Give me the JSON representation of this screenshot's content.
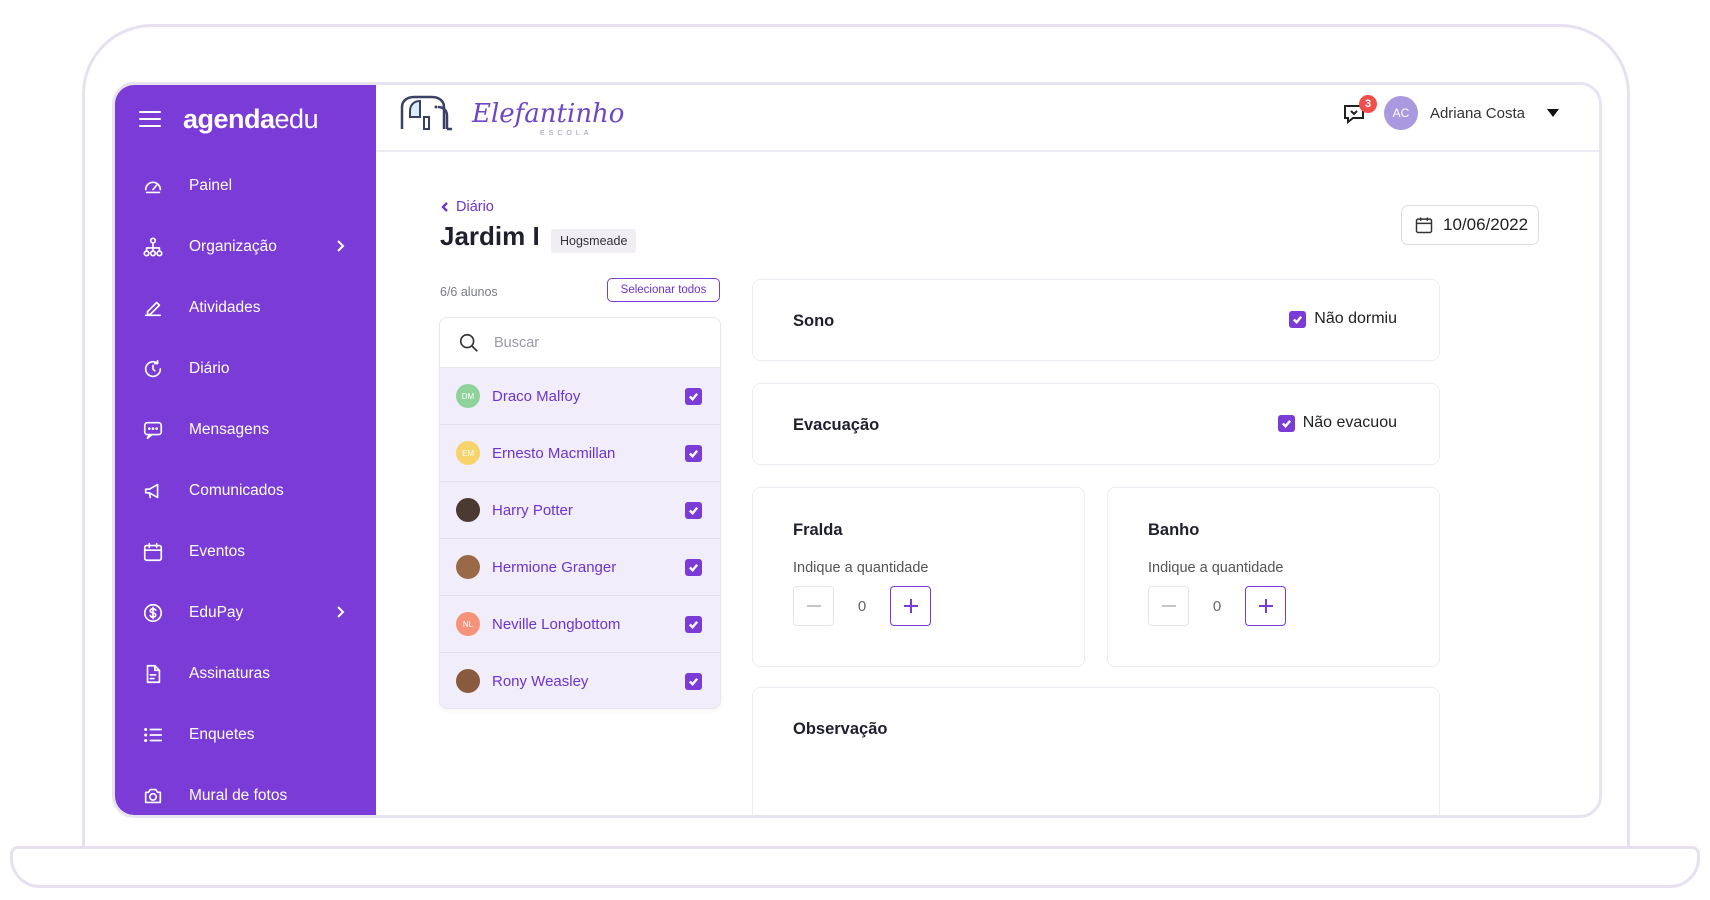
{
  "brand": {
    "name_bold": "agenda",
    "name_light": "edu"
  },
  "sidebar": {
    "items": [
      {
        "label": "Painel",
        "icon": "gauge-icon",
        "chevron": false
      },
      {
        "label": "Organização",
        "icon": "org-chart-icon",
        "chevron": true
      },
      {
        "label": "Atividades",
        "icon": "pencil-icon",
        "chevron": false
      },
      {
        "label": "Diário",
        "icon": "clock-refresh-icon",
        "chevron": false
      },
      {
        "label": "Mensagens",
        "icon": "message-icon",
        "chevron": false
      },
      {
        "label": "Comunicados",
        "icon": "megaphone-icon",
        "chevron": false
      },
      {
        "label": "Eventos",
        "icon": "calendar-icon",
        "chevron": false
      },
      {
        "label": "EduPay",
        "icon": "dollar-icon",
        "chevron": true
      },
      {
        "label": "Assinaturas",
        "icon": "document-icon",
        "chevron": false
      },
      {
        "label": "Enquetes",
        "icon": "list-icon",
        "chevron": false
      },
      {
        "label": "Mural de fotos",
        "icon": "camera-icon",
        "chevron": false
      }
    ]
  },
  "topbar": {
    "school_name": "Elefantinho",
    "school_sub": "ESCOLA",
    "notification_count": "3",
    "user_initials": "AC",
    "user_name": "Adriana Costa"
  },
  "page": {
    "back_label": "Diário",
    "class_title": "Jardim I",
    "class_tag": "Hogsmeade",
    "date": "10/06/2022"
  },
  "students": {
    "count_label": "6/6 alunos",
    "select_all_label": "Selecionar todos",
    "search_placeholder": "Buscar",
    "list": [
      {
        "initials": "DM",
        "name": "Draco Malfoy",
        "color": "#8fd39a",
        "checked": true
      },
      {
        "initials": "EM",
        "name": "Ernesto Macmillan",
        "color": "#f7d36b",
        "checked": true
      },
      {
        "initials": "",
        "name": "Harry Potter",
        "color": "#4a3a32",
        "checked": true
      },
      {
        "initials": "",
        "name": "Hermione Granger",
        "color": "#9a6a48",
        "checked": true
      },
      {
        "initials": "NL",
        "name": "Neville Longbottom",
        "color": "#f4937a",
        "checked": true
      },
      {
        "initials": "",
        "name": "Rony Weasley",
        "color": "#8a5a3e",
        "checked": true
      }
    ]
  },
  "cards": {
    "sono": {
      "title": "Sono",
      "check_label": "Não dormiu",
      "checked": true
    },
    "evacuacao": {
      "title": "Evacuação",
      "check_label": "Não evacuou",
      "checked": true
    },
    "fralda": {
      "title": "Fralda",
      "hint": "Indique a quantidade",
      "value": "0"
    },
    "banho": {
      "title": "Banho",
      "hint": "Indique a quantidade",
      "value": "0"
    },
    "observacao": {
      "title": "Observação"
    }
  },
  "colors": {
    "primary": "#7a3bd7",
    "badge": "#f04d4d",
    "row_bg": "#f1edfa"
  }
}
